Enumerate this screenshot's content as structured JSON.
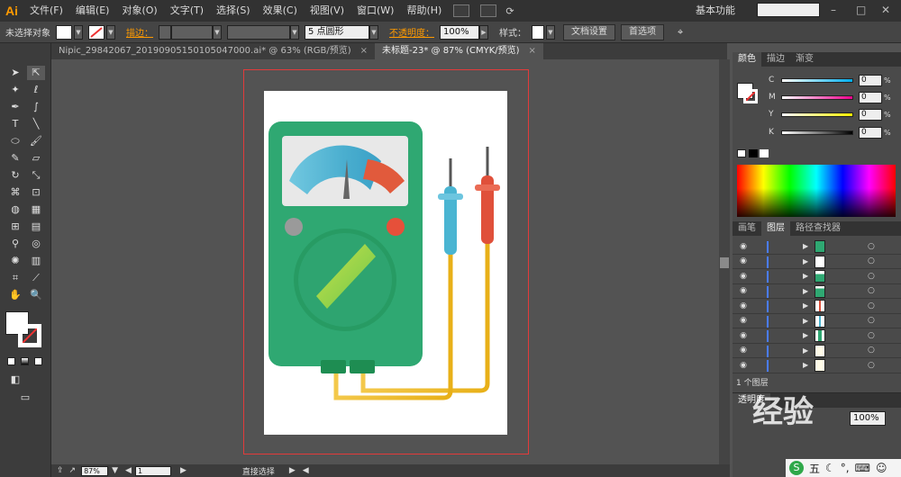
{
  "app": {
    "logo": "Ai",
    "workspace": "基本功能"
  },
  "menu": [
    "文件(F)",
    "编辑(E)",
    "对象(O)",
    "文字(T)",
    "选择(S)",
    "效果(C)",
    "视图(V)",
    "窗口(W)",
    "帮助(H)"
  ],
  "control": {
    "selection": "未选择对象",
    "stroke_label": "描边：",
    "brush": "5 点圆形",
    "opacity_label": "不透明度：",
    "opacity_value": "100%",
    "style_label": "样式：",
    "doc_setup": "文档设置",
    "prefs": "首选项"
  },
  "tabs": [
    {
      "label": "Nipic_29842067_20190905150105047000.ai* @ 63% (RGB/预览)",
      "close": "×"
    },
    {
      "label": "未标题-23* @ 87% (CMYK/预览)",
      "close": "×"
    }
  ],
  "status": {
    "zoom": "87%",
    "page": "1",
    "tool": "直接选择"
  },
  "color_panel": {
    "tabs": [
      "颜色",
      "描边",
      "渐变"
    ],
    "sliders": [
      {
        "label": "C",
        "value": "0",
        "unit": "%",
        "color": "#00aeef"
      },
      {
        "label": "M",
        "value": "0",
        "unit": "%",
        "color": "#ec008c"
      },
      {
        "label": "Y",
        "value": "0",
        "unit": "%",
        "color": "#fff200"
      },
      {
        "label": "K",
        "value": "0",
        "unit": "%",
        "color": "#000000"
      }
    ]
  },
  "layers_panel": {
    "tabs": [
      "画笔",
      "图层",
      "路径查找器"
    ],
    "footer": "1 个图层"
  },
  "transparency": {
    "tab": "透明度",
    "value": "100%"
  },
  "watermark": "经验",
  "ime": {
    "logo": "S",
    "text": "五"
  },
  "colors": {
    "body": "#2fa872",
    "screen_frame": "#e8e8e8",
    "blue_probe": "#4ab5d2",
    "red_probe": "#e0503a",
    "wire": "#f0c22a",
    "knob": "#279b63"
  }
}
